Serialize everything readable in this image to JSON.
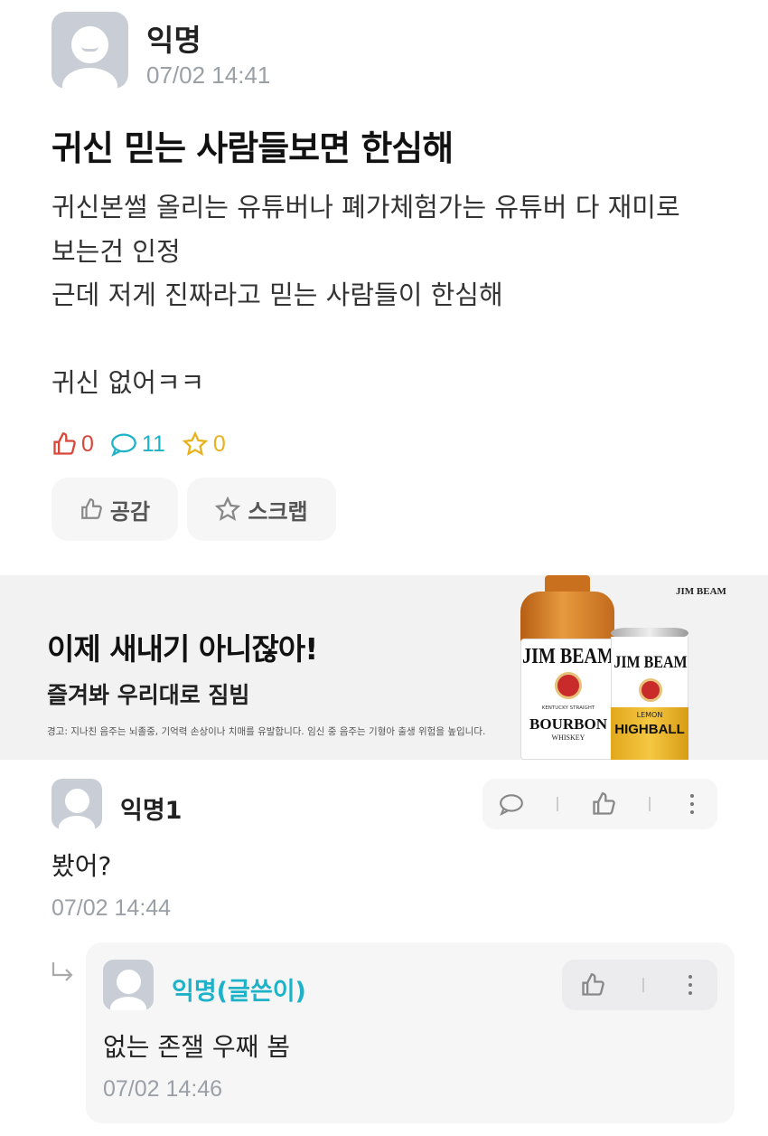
{
  "post": {
    "author": "익명",
    "time": "07/02 14:41",
    "title": "귀신 믿는 사람들보면 한심해",
    "body_lines": [
      "귀신본썰 올리는 유튜버나 폐가체험가는 유튜버 다 재미로",
      "보는건 인정",
      "근데 저게 진짜라고 믿는 사람들이 한심해",
      "",
      "귀신 없어ㅋㅋ"
    ],
    "stats": {
      "likes": "0",
      "comments": "11",
      "scraps": "0"
    },
    "buttons": {
      "like_label": "공감",
      "scrap_label": "스크랩"
    }
  },
  "ad": {
    "headline": "이제 새내기 아니잖아!",
    "subline": "즐겨봐 우리대로 짐빔",
    "warning": "경고: 지나친 음주는 뇌졸중, 기억력 손상이나 치매를 유발합니다. 임신 중 음주는 기형아 출생 위험을 높입니다.",
    "brand_logo": "JIM BEAM",
    "bottle": {
      "brand": "JIM BEAM",
      "small": "KENTUCKY STRAIGHT",
      "type": "BOURBON",
      "sub": "WHISKEY"
    },
    "can": {
      "brand": "JIM BEAM",
      "flavor": "LEMON",
      "type": "HIGHBALL"
    }
  },
  "comments": [
    {
      "author": "익명1",
      "body": "봤어?",
      "time": "07/02 14:44",
      "is_reply": false
    },
    {
      "author": "익명(글쓴이)",
      "body": "없는 존잴 우째 봄",
      "time": "07/02 14:46",
      "is_reply": true
    }
  ],
  "colors": {
    "like": "#d9463a",
    "comment": "#1db2c8",
    "scrap": "#e8b21f",
    "author_op": "#1db2c8"
  }
}
